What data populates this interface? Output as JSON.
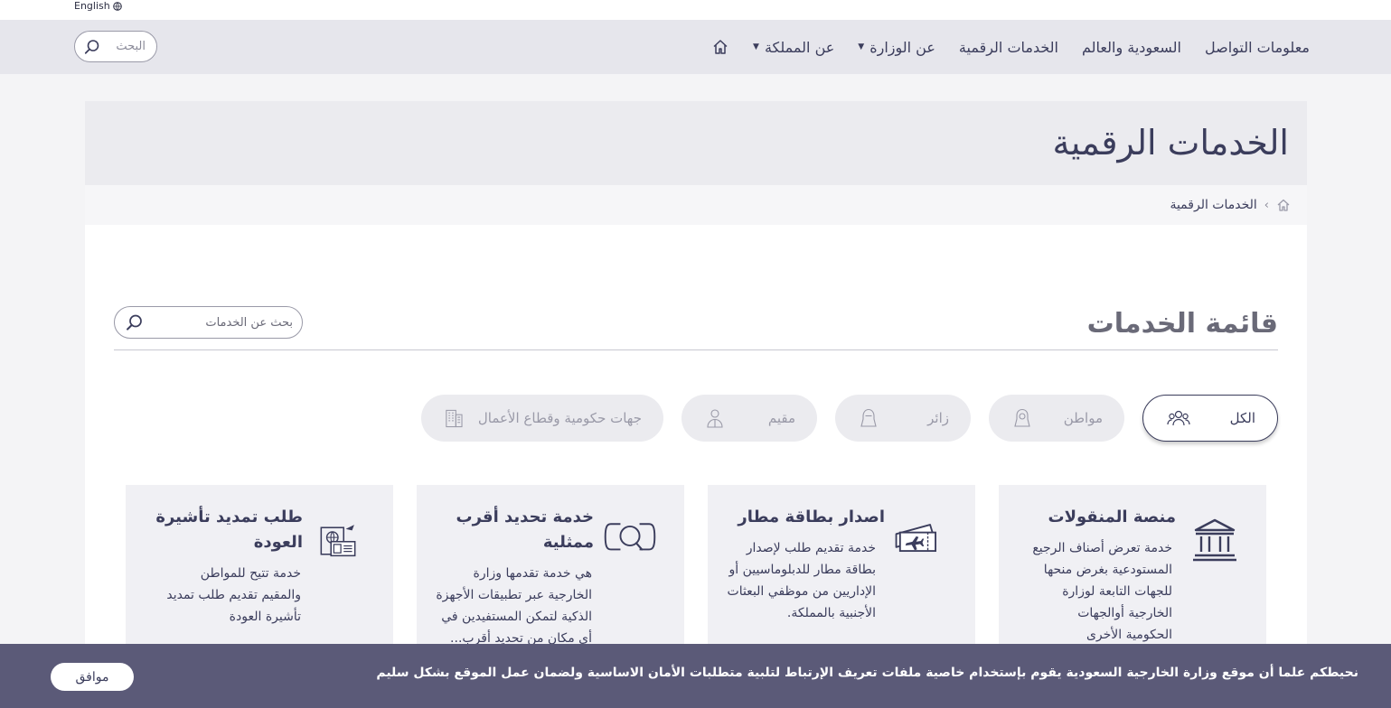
{
  "lang_switch": {
    "label": "English"
  },
  "nav": {
    "search_placeholder": "البحث",
    "items": [
      {
        "label": "عن المملكة",
        "has_dropdown": true
      },
      {
        "label": "عن الوزارة",
        "has_dropdown": true
      },
      {
        "label": "الخدمات الرقمية",
        "has_dropdown": false
      },
      {
        "label": "السعودية والعالم",
        "has_dropdown": false
      },
      {
        "label": "معلومات التواصل",
        "has_dropdown": false
      }
    ]
  },
  "hero": {
    "title": "الخدمات الرقمية"
  },
  "breadcrumb": {
    "current": "الخدمات الرقمية"
  },
  "services": {
    "list_title": "قائمة الخدمات",
    "search_placeholder": "بحث عن الخدمات",
    "filters": [
      {
        "label": "الكل",
        "icon": "group-icon",
        "active": true
      },
      {
        "label": "مواطن",
        "icon": "citizen-icon",
        "active": false
      },
      {
        "label": "زائر",
        "icon": "visitor-icon",
        "active": false
      },
      {
        "label": "مقيم",
        "icon": "resident-icon",
        "active": false
      },
      {
        "label": "جهات حكومية وقطاع الأعمال",
        "icon": "building-icon",
        "active": false
      }
    ],
    "cards": [
      {
        "title": "منصة المنقولات",
        "description": "خدمة تعرض أصناف الرجيع المستودعية بغرض منحها للجهات التابعة لوزارة الخارجية أوالجهات الحكومية الأخرى",
        "icon": "institution-icon"
      },
      {
        "title": "اصدار بطاقة مطار",
        "description": "خدمة تقديم طلب لإصدار بطاقة مطار للدبلوماسيين أو الإداريين من موظفي البعثات الأجنبية بالمملكة.",
        "icon": "airport-ticket-icon"
      },
      {
        "title": "خدمة تحديد أقرب ممثلية",
        "description": "هي خدمة تقدمها وزارة الخارجية عبر تطبيقات الأجهزة الذكية لتمكن المستفيدين في أي مكان من تحديد أقرب...",
        "icon": "locate-icon"
      },
      {
        "title": "طلب تمديد تأشيرة العودة",
        "description": "خدمة تتيح للمواطن والمقيم تقديم طلب تمديد تأشيرة العودة",
        "icon": "passport-icon"
      }
    ]
  },
  "cookie_banner": {
    "message": "نحيطكم علما أن موقع وزارة الخارجية السعودية يقوم بإستخدام خاصية ملفات تعريف الإرتباط لتلبية متطلبات الأمان الاساسية ولضمان عمل الموقع بشكل سليم",
    "accept_label": "موافق"
  }
}
